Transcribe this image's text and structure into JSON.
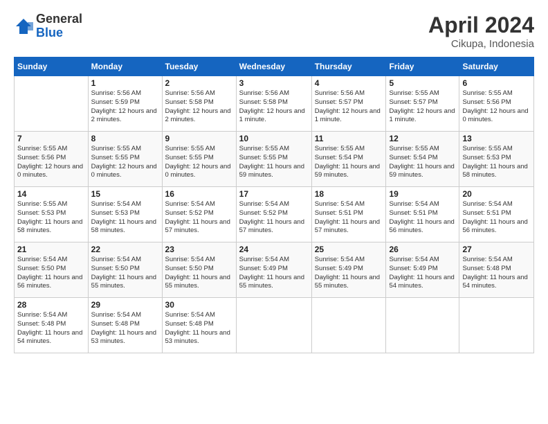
{
  "logo": {
    "general": "General",
    "blue": "Blue"
  },
  "header": {
    "month": "April 2024",
    "location": "Cikupa, Indonesia"
  },
  "weekdays": [
    "Sunday",
    "Monday",
    "Tuesday",
    "Wednesday",
    "Thursday",
    "Friday",
    "Saturday"
  ],
  "weeks": [
    [
      {
        "day": "",
        "sunrise": "",
        "sunset": "",
        "daylight": ""
      },
      {
        "day": "1",
        "sunrise": "Sunrise: 5:56 AM",
        "sunset": "Sunset: 5:59 PM",
        "daylight": "Daylight: 12 hours and 2 minutes."
      },
      {
        "day": "2",
        "sunrise": "Sunrise: 5:56 AM",
        "sunset": "Sunset: 5:58 PM",
        "daylight": "Daylight: 12 hours and 2 minutes."
      },
      {
        "day": "3",
        "sunrise": "Sunrise: 5:56 AM",
        "sunset": "Sunset: 5:58 PM",
        "daylight": "Daylight: 12 hours and 1 minute."
      },
      {
        "day": "4",
        "sunrise": "Sunrise: 5:56 AM",
        "sunset": "Sunset: 5:57 PM",
        "daylight": "Daylight: 12 hours and 1 minute."
      },
      {
        "day": "5",
        "sunrise": "Sunrise: 5:55 AM",
        "sunset": "Sunset: 5:57 PM",
        "daylight": "Daylight: 12 hours and 1 minute."
      },
      {
        "day": "6",
        "sunrise": "Sunrise: 5:55 AM",
        "sunset": "Sunset: 5:56 PM",
        "daylight": "Daylight: 12 hours and 0 minutes."
      }
    ],
    [
      {
        "day": "7",
        "sunrise": "Sunrise: 5:55 AM",
        "sunset": "Sunset: 5:56 PM",
        "daylight": "Daylight: 12 hours and 0 minutes."
      },
      {
        "day": "8",
        "sunrise": "Sunrise: 5:55 AM",
        "sunset": "Sunset: 5:55 PM",
        "daylight": "Daylight: 12 hours and 0 minutes."
      },
      {
        "day": "9",
        "sunrise": "Sunrise: 5:55 AM",
        "sunset": "Sunset: 5:55 PM",
        "daylight": "Daylight: 12 hours and 0 minutes."
      },
      {
        "day": "10",
        "sunrise": "Sunrise: 5:55 AM",
        "sunset": "Sunset: 5:55 PM",
        "daylight": "Daylight: 11 hours and 59 minutes."
      },
      {
        "day": "11",
        "sunrise": "Sunrise: 5:55 AM",
        "sunset": "Sunset: 5:54 PM",
        "daylight": "Daylight: 11 hours and 59 minutes."
      },
      {
        "day": "12",
        "sunrise": "Sunrise: 5:55 AM",
        "sunset": "Sunset: 5:54 PM",
        "daylight": "Daylight: 11 hours and 59 minutes."
      },
      {
        "day": "13",
        "sunrise": "Sunrise: 5:55 AM",
        "sunset": "Sunset: 5:53 PM",
        "daylight": "Daylight: 11 hours and 58 minutes."
      }
    ],
    [
      {
        "day": "14",
        "sunrise": "Sunrise: 5:55 AM",
        "sunset": "Sunset: 5:53 PM",
        "daylight": "Daylight: 11 hours and 58 minutes."
      },
      {
        "day": "15",
        "sunrise": "Sunrise: 5:54 AM",
        "sunset": "Sunset: 5:53 PM",
        "daylight": "Daylight: 11 hours and 58 minutes."
      },
      {
        "day": "16",
        "sunrise": "Sunrise: 5:54 AM",
        "sunset": "Sunset: 5:52 PM",
        "daylight": "Daylight: 11 hours and 57 minutes."
      },
      {
        "day": "17",
        "sunrise": "Sunrise: 5:54 AM",
        "sunset": "Sunset: 5:52 PM",
        "daylight": "Daylight: 11 hours and 57 minutes."
      },
      {
        "day": "18",
        "sunrise": "Sunrise: 5:54 AM",
        "sunset": "Sunset: 5:51 PM",
        "daylight": "Daylight: 11 hours and 57 minutes."
      },
      {
        "day": "19",
        "sunrise": "Sunrise: 5:54 AM",
        "sunset": "Sunset: 5:51 PM",
        "daylight": "Daylight: 11 hours and 56 minutes."
      },
      {
        "day": "20",
        "sunrise": "Sunrise: 5:54 AM",
        "sunset": "Sunset: 5:51 PM",
        "daylight": "Daylight: 11 hours and 56 minutes."
      }
    ],
    [
      {
        "day": "21",
        "sunrise": "Sunrise: 5:54 AM",
        "sunset": "Sunset: 5:50 PM",
        "daylight": "Daylight: 11 hours and 56 minutes."
      },
      {
        "day": "22",
        "sunrise": "Sunrise: 5:54 AM",
        "sunset": "Sunset: 5:50 PM",
        "daylight": "Daylight: 11 hours and 55 minutes."
      },
      {
        "day": "23",
        "sunrise": "Sunrise: 5:54 AM",
        "sunset": "Sunset: 5:50 PM",
        "daylight": "Daylight: 11 hours and 55 minutes."
      },
      {
        "day": "24",
        "sunrise": "Sunrise: 5:54 AM",
        "sunset": "Sunset: 5:49 PM",
        "daylight": "Daylight: 11 hours and 55 minutes."
      },
      {
        "day": "25",
        "sunrise": "Sunrise: 5:54 AM",
        "sunset": "Sunset: 5:49 PM",
        "daylight": "Daylight: 11 hours and 55 minutes."
      },
      {
        "day": "26",
        "sunrise": "Sunrise: 5:54 AM",
        "sunset": "Sunset: 5:49 PM",
        "daylight": "Daylight: 11 hours and 54 minutes."
      },
      {
        "day": "27",
        "sunrise": "Sunrise: 5:54 AM",
        "sunset": "Sunset: 5:48 PM",
        "daylight": "Daylight: 11 hours and 54 minutes."
      }
    ],
    [
      {
        "day": "28",
        "sunrise": "Sunrise: 5:54 AM",
        "sunset": "Sunset: 5:48 PM",
        "daylight": "Daylight: 11 hours and 54 minutes."
      },
      {
        "day": "29",
        "sunrise": "Sunrise: 5:54 AM",
        "sunset": "Sunset: 5:48 PM",
        "daylight": "Daylight: 11 hours and 53 minutes."
      },
      {
        "day": "30",
        "sunrise": "Sunrise: 5:54 AM",
        "sunset": "Sunset: 5:48 PM",
        "daylight": "Daylight: 11 hours and 53 minutes."
      },
      {
        "day": "",
        "sunrise": "",
        "sunset": "",
        "daylight": ""
      },
      {
        "day": "",
        "sunrise": "",
        "sunset": "",
        "daylight": ""
      },
      {
        "day": "",
        "sunrise": "",
        "sunset": "",
        "daylight": ""
      },
      {
        "day": "",
        "sunrise": "",
        "sunset": "",
        "daylight": ""
      }
    ]
  ]
}
